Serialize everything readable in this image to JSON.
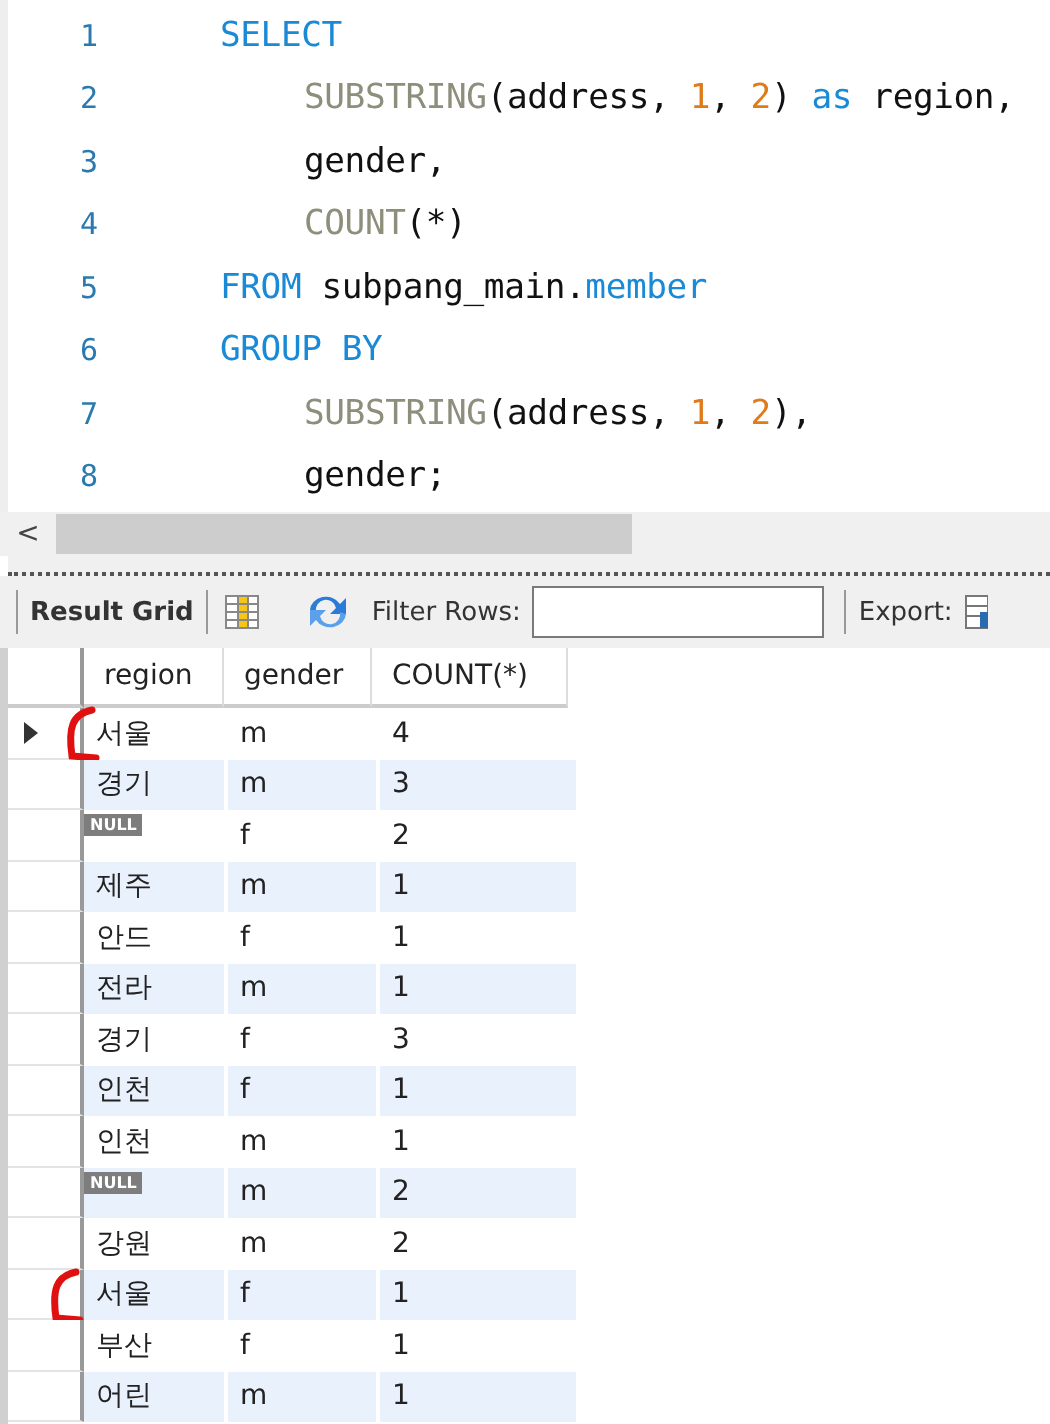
{
  "editor": {
    "lines": [
      {
        "number": "1",
        "nested": false,
        "tokens": [
          {
            "kind": "keyword",
            "text": "SELECT"
          }
        ]
      },
      {
        "number": "2",
        "nested": true,
        "tokens": [
          {
            "kind": "function",
            "text": "SUBSTRING"
          },
          {
            "kind": "plain",
            "text": "(address, "
          },
          {
            "kind": "number",
            "text": "1"
          },
          {
            "kind": "plain",
            "text": ", "
          },
          {
            "kind": "number",
            "text": "2"
          },
          {
            "kind": "plain",
            "text": ") "
          },
          {
            "kind": "keyword",
            "text": "as"
          },
          {
            "kind": "plain",
            "text": " region,"
          }
        ]
      },
      {
        "number": "3",
        "nested": true,
        "tokens": [
          {
            "kind": "plain",
            "text": "gender,"
          }
        ]
      },
      {
        "number": "4",
        "nested": true,
        "tokens": [
          {
            "kind": "function",
            "text": "COUNT"
          },
          {
            "kind": "plain",
            "text": "(*)"
          }
        ]
      },
      {
        "number": "5",
        "nested": false,
        "tokens": [
          {
            "kind": "keyword",
            "text": "FROM"
          },
          {
            "kind": "plain",
            "text": " subpang_main."
          },
          {
            "kind": "keyword",
            "text": "member"
          }
        ]
      },
      {
        "number": "6",
        "nested": false,
        "tokens": [
          {
            "kind": "keyword",
            "text": "GROUP BY"
          }
        ]
      },
      {
        "number": "7",
        "nested": true,
        "tokens": [
          {
            "kind": "function",
            "text": "SUBSTRING"
          },
          {
            "kind": "plain",
            "text": "(address, "
          },
          {
            "kind": "number",
            "text": "1"
          },
          {
            "kind": "plain",
            "text": ", "
          },
          {
            "kind": "number",
            "text": "2"
          },
          {
            "kind": "plain",
            "text": "),"
          }
        ]
      },
      {
        "number": "8",
        "nested": true,
        "tokens": [
          {
            "kind": "plain",
            "text": "gender;"
          }
        ]
      }
    ]
  },
  "scroll_left": "<",
  "toolbar": {
    "result_grid": "Result Grid",
    "filter_label": "Filter Rows:",
    "export_label": "Export:"
  },
  "grid": {
    "columns": [
      "region",
      "gender",
      "COUNT(*)"
    ],
    "rows": [
      {
        "region": "서울",
        "region_null": false,
        "gender": "m",
        "count": "4",
        "selected": true,
        "marked": true
      },
      {
        "region": "경기",
        "region_null": false,
        "gender": "m",
        "count": "3",
        "selected": false,
        "marked": false
      },
      {
        "region": "NULL",
        "region_null": true,
        "gender": "f",
        "count": "2",
        "selected": false,
        "marked": false
      },
      {
        "region": "제주",
        "region_null": false,
        "gender": "m",
        "count": "1",
        "selected": false,
        "marked": false
      },
      {
        "region": "안드",
        "region_null": false,
        "gender": "f",
        "count": "1",
        "selected": false,
        "marked": false
      },
      {
        "region": "전라",
        "region_null": false,
        "gender": "m",
        "count": "1",
        "selected": false,
        "marked": false
      },
      {
        "region": "경기",
        "region_null": false,
        "gender": "f",
        "count": "3",
        "selected": false,
        "marked": false
      },
      {
        "region": "인천",
        "region_null": false,
        "gender": "f",
        "count": "1",
        "selected": false,
        "marked": false
      },
      {
        "region": "인천",
        "region_null": false,
        "gender": "m",
        "count": "1",
        "selected": false,
        "marked": false
      },
      {
        "region": "NULL",
        "region_null": true,
        "gender": "m",
        "count": "2",
        "selected": false,
        "marked": false
      },
      {
        "region": "강원",
        "region_null": false,
        "gender": "m",
        "count": "2",
        "selected": false,
        "marked": false
      },
      {
        "region": "서울",
        "region_null": false,
        "gender": "f",
        "count": "1",
        "selected": false,
        "marked": true
      },
      {
        "region": "부산",
        "region_null": false,
        "gender": "f",
        "count": "1",
        "selected": false,
        "marked": false
      },
      {
        "region": "어린",
        "region_null": false,
        "gender": "m",
        "count": "1",
        "selected": false,
        "marked": false
      }
    ]
  }
}
